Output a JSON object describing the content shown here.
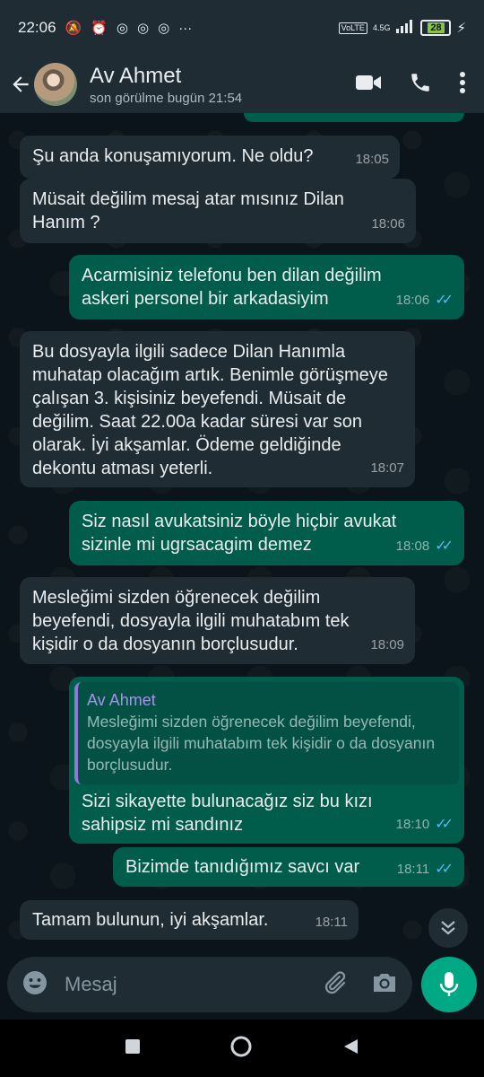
{
  "status_bar": {
    "time": "22:06",
    "network": "4.5G",
    "lte": "VoLTE",
    "battery": "28"
  },
  "header": {
    "contact_name": "Av Ahmet",
    "last_seen": "son görülme bugün 21:54"
  },
  "messages": [
    {
      "dir": "in",
      "text": "Şu anda konuşamıyorum. Ne oldu?",
      "time": "18:05"
    },
    {
      "dir": "in",
      "text": "Müsait değilim mesaj atar mısınız Dilan Hanım ?",
      "time": "18:06"
    },
    {
      "dir": "out",
      "text": "Acarmisiniz telefonu ben dilan değilim askeri personel bir arkadasiyim",
      "time": "18:06"
    },
    {
      "dir": "in",
      "text": "Bu dosyayla ilgili sadece Dilan Hanımla muhatap olacağım artık. Benimle görüşmeye çalışan 3. kişisiniz beyefendi. Müsait de değilim. Saat 22.00a kadar süresi var son olarak. İyi akşamlar. Ödeme geldiğinde dekontu atması yeterli.",
      "time": "18:07"
    },
    {
      "dir": "out",
      "text": "Siz nasıl avukatsiniz böyle hiçbir avukat sizinle mi ugrsacagim demez",
      "time": "18:08"
    },
    {
      "dir": "in",
      "text": "Mesleğimi sizden öğrenecek değilim beyefendi, dosyayla ilgili muhatabım tek kişidir o da dosyanın borçlusudur.",
      "time": "18:09"
    },
    {
      "dir": "out",
      "quote_name": "Av Ahmet",
      "quote_text": "Mesleğimi sizden öğrenecek değilim beyefendi, dosyayla ilgili muhatabım tek kişidir o da dosyanın borçlusudur.",
      "text": "Sizi sikayette bulunacağız siz bu kızı sahipsiz mi sandınız",
      "time": "18:10"
    },
    {
      "dir": "out",
      "text": "Bizimde tanıdığımız savcı var",
      "time": "18:11"
    },
    {
      "dir": "in",
      "text": "Tamam bulunun, iyi akşamlar.",
      "time": "18:11"
    }
  ],
  "composer": {
    "placeholder": "Mesaj"
  },
  "colors": {
    "incoming_bubble": "#202c33",
    "outgoing_bubble": "#005c4b",
    "read_ticks": "#53bdeb",
    "accent": "#00a884"
  }
}
